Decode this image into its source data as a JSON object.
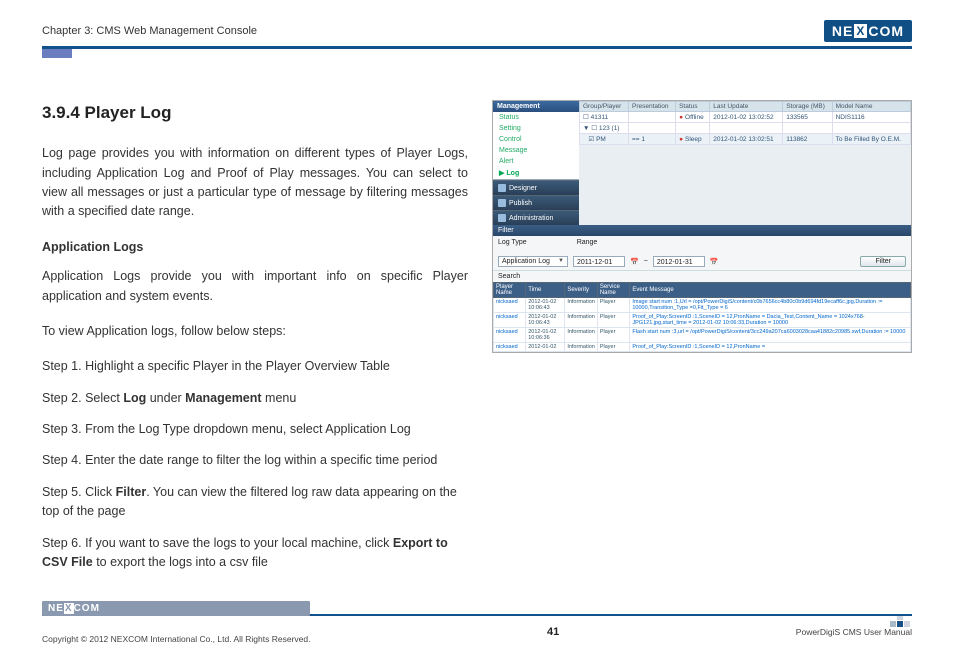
{
  "header": {
    "chapter": "Chapter 3: CMS Web Management Console",
    "brand": "NEXCOM"
  },
  "doc": {
    "title": "3.9.4 Player Log",
    "intro": "Log page provides you with information on different types of Player Logs, including Application Log and Proof of Play messages. You can select to view all messages or just a particular type of message by filtering messages with a specified date range.",
    "subhead": "Application Logs",
    "app_intro": "Application Logs provide you with important info on specific Player application and system events.",
    "steps_lead": "To view Application logs, follow below steps:",
    "s1": "Step 1. Highlight a specific Player in the Player Overview Table",
    "s2_a": "Step 2. Select ",
    "s2_b": "Log",
    "s2_c": " under ",
    "s2_d": "Management",
    "s2_e": " menu",
    "s3": "Step 3. From the Log Type dropdown menu, select Application Log",
    "s4": "Step 4. Enter the date range to filter the log within a specific time period",
    "s5_a": "Step 5. Click ",
    "s5_b": "Filter",
    "s5_c": ". You can view the filtered log raw data appearing on the top of the page",
    "s6_a": "Step 6. If you want to save the logs to your local machine, click ",
    "s6_b": "Export to CSV File",
    "s6_c": " to export the logs into a csv file"
  },
  "shot": {
    "sidebar": {
      "management": "Management",
      "items": [
        "Status",
        "Setting",
        "Control",
        "Message",
        "Alert",
        "Log"
      ],
      "designer": "Designer",
      "publish": "Publish",
      "admin": "Administration"
    },
    "table": {
      "headers": [
        "Group/Player",
        "Presentation",
        "Status",
        "Last Update",
        "Storage (MB)",
        "Model Name"
      ],
      "rows": [
        {
          "gp": "41311",
          "pres": "",
          "status": "Offline",
          "upd": "2012-01-02 13:02:52",
          "stor": "133565",
          "model": "NDIS1116"
        },
        {
          "gp": "123 (1)",
          "pres": "",
          "status": "",
          "upd": "",
          "stor": "",
          "model": ""
        },
        {
          "gp": "PM",
          "pres": "== 1",
          "status": "Sleep",
          "upd": "2012-01-02 13:02:51",
          "stor": "113862",
          "model": "To Be Filled By O.E.M."
        }
      ]
    },
    "filter": {
      "label": "Filter",
      "logtype_label": "Log Type",
      "logtype_value": "Application Log",
      "range_label": "Range",
      "date_from": "2011-12-01",
      "date_to": "2012-01-31",
      "button": "Filter",
      "search_label": "Search"
    },
    "log": {
      "headers": [
        "Player Name",
        "Time",
        "Severity",
        "Service Name",
        "Event Message"
      ],
      "rows": [
        {
          "pn": "nicksaed",
          "time": "2012-01-02 10:06:43",
          "sev": "Information",
          "svc": "Player",
          "msg": "Image start num :1,Url = /opt/PowerDigiS/content/c0b7656cc4b80c0b9d694fd19ecaff6c.jpg,Duration := 10000,Transition_Type =0,Fit_Type = 6"
        },
        {
          "pn": "nicksaed",
          "time": "2012-01-02 10:06:43",
          "sev": "Information",
          "svc": "Player",
          "msg": "Proof_of_Play:ScreenID :1,SceneID = 12,PronName = Dacia_Test,Content_Name = 1024x768-JPG121.jpg,start_time = 2012-01-02 10:06:33,Duration = 10000"
        },
        {
          "pn": "nicksaed",
          "time": "2012-01-02 10:06:36",
          "sev": "Information",
          "svc": "Player",
          "msg": "Flash start num :3,url = /opt/PowerDigiS/content/3cc249a207ca6003028caa41882c20985.swf,Duration := 10000"
        },
        {
          "pn": "nicksaed",
          "time": "2012-01-02",
          "sev": "Information",
          "svc": "Player",
          "msg": "Proof_of_Play:ScreenID :1,SceneID = 12,PronName ="
        }
      ]
    }
  },
  "footer": {
    "copyright": "Copyright © 2012 NEXCOM International Co., Ltd. All Rights Reserved.",
    "page": "41",
    "manual": "PowerDigiS CMS User Manual",
    "brand": "NEXCOM"
  }
}
